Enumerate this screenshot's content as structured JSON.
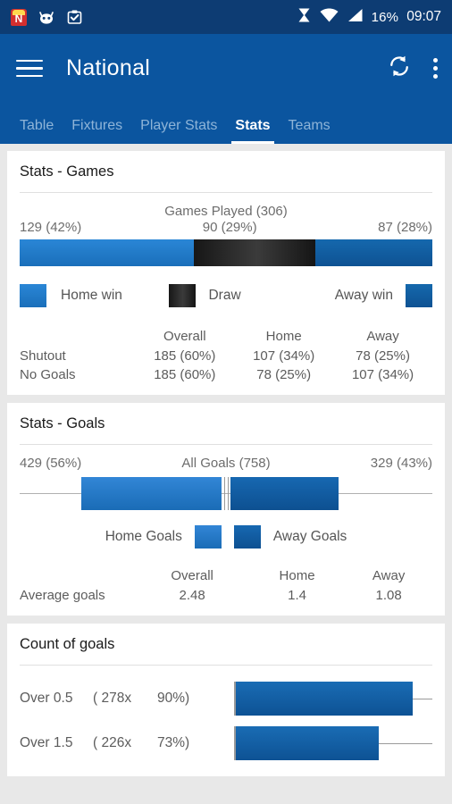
{
  "statusbar": {
    "icons": [
      "app-notification-icon",
      "cyanogen-robot-icon",
      "clipboard-check-icon"
    ],
    "battery": "16%",
    "time": "09:07"
  },
  "appbar": {
    "menu_icon": "hamburger-menu-icon",
    "title": "National",
    "refresh_icon": "sync-refresh-icon",
    "overflow_icon": "overflow-menu-icon"
  },
  "tabs": [
    {
      "label": "Table",
      "active": false
    },
    {
      "label": "Fixtures",
      "active": false
    },
    {
      "label": "Player Stats",
      "active": false
    },
    {
      "label": "Stats",
      "active": true
    },
    {
      "label": "Teams",
      "active": false
    }
  ],
  "colors": {
    "home_blue": "#2a86d6",
    "away_blue": "#1264a8",
    "draw_black": "#2a2a2a",
    "app_blue": "#0b559f",
    "status_blue": "#0d3c73"
  },
  "games_card": {
    "title": "Stats - Games",
    "caption": "Games Played (306)",
    "left_label": "129 (42%)",
    "mid_label": "90 (29%)",
    "right_label": "87 (28%)",
    "legend": {
      "home": "Home win",
      "draw": "Draw",
      "away": "Away win"
    },
    "table": {
      "columns": [
        "",
        "Overall",
        "Home",
        "Away"
      ],
      "rows": [
        {
          "label": "Shutout",
          "overall": "185 (60%)",
          "home": "107 (34%)",
          "away": "78 (25%)"
        },
        {
          "label": "No Goals",
          "overall": "185 (60%)",
          "home": "78 (25%)",
          "away": "107 (34%)"
        }
      ]
    }
  },
  "goals_card": {
    "title": "Stats - Goals",
    "caption": "All Goals (758)",
    "left_label": "429 (56%)",
    "right_label": "329 (43%)",
    "legend": {
      "home": "Home Goals",
      "away": "Away Goals"
    },
    "table": {
      "columns": [
        "",
        "Overall",
        "Home",
        "Away"
      ],
      "rows": [
        {
          "label": "Average goals",
          "overall": "2.48",
          "home": "1.4",
          "away": "1.08"
        }
      ]
    }
  },
  "count_card": {
    "title": "Count of goals",
    "rows": [
      {
        "label": "Over 0.5",
        "count": "( 278x",
        "pct": "90%)"
      },
      {
        "label": "Over 1.5",
        "count": "( 226x",
        "pct": "73%)"
      }
    ]
  },
  "chart_data": [
    {
      "type": "bar",
      "title": "Games Played (306)",
      "orientation": "horizontal-stacked",
      "categories": [
        "Home win",
        "Draw",
        "Away win"
      ],
      "values": [
        129,
        90,
        87
      ],
      "percents": [
        42,
        29,
        28
      ],
      "labels": [
        "129 (42%)",
        "90 (29%)",
        "87 (28%)"
      ],
      "colors": [
        "#2a86d6",
        "#2a2a2a",
        "#1264a8"
      ],
      "total": 306,
      "grid": false,
      "legend": "below"
    },
    {
      "type": "bar",
      "title": "All Goals (758)",
      "orientation": "horizontal-diverging",
      "categories": [
        "Home Goals",
        "Away Goals"
      ],
      "values": [
        429,
        329
      ],
      "percents": [
        56,
        43
      ],
      "labels": [
        "429 (56%)",
        "329 (43%)"
      ],
      "colors": [
        "#2a86d6",
        "#1264a8"
      ],
      "total": 758,
      "grid": false,
      "legend": "below"
    },
    {
      "type": "bar",
      "title": "Count of goals",
      "orientation": "horizontal",
      "categories": [
        "Over 0.5",
        "Over 1.5"
      ],
      "values": [
        278,
        226
      ],
      "percents": [
        90,
        73
      ],
      "xlabel": "",
      "ylabel": "",
      "xlim": [
        0,
        100
      ],
      "grid": false
    },
    {
      "type": "table",
      "title": "Stats - Games",
      "columns": [
        "",
        "Overall",
        "Home",
        "Away"
      ],
      "rows": [
        [
          "Shutout",
          "185 (60%)",
          "107 (34%)",
          "78 (25%)"
        ],
        [
          "No Goals",
          "185 (60%)",
          "78 (25%)",
          "107 (34%)"
        ]
      ]
    },
    {
      "type": "table",
      "title": "Stats - Goals",
      "columns": [
        "",
        "Overall",
        "Home",
        "Away"
      ],
      "rows": [
        [
          "Average goals",
          "2.48",
          "1.4",
          "1.08"
        ]
      ]
    }
  ]
}
